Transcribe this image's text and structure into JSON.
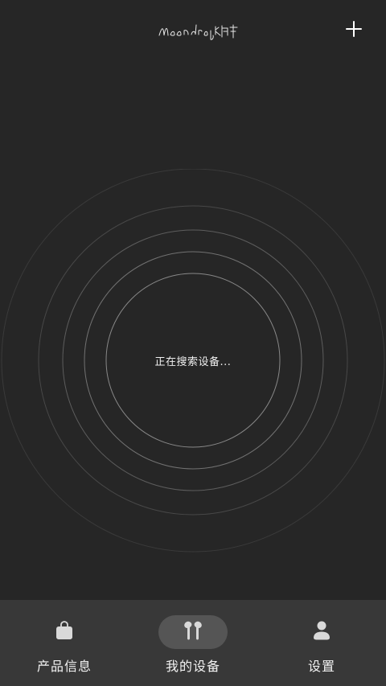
{
  "header": {
    "logo_icon": "moondrop-signature-logo",
    "add_icon": "plus-icon"
  },
  "main": {
    "status_text": "正在搜索设备..."
  },
  "tabbar": {
    "items": [
      {
        "label": "产品信息",
        "icon": "shopping-bag-icon",
        "active": false
      },
      {
        "label": "我的设备",
        "icon": "earbuds-icon",
        "active": true
      },
      {
        "label": "设置",
        "icon": "person-icon",
        "active": false
      }
    ]
  },
  "colors": {
    "background": "#262626",
    "tabbar": "#383838",
    "active_tab_pill": "#555555",
    "text": "#f0f0f0",
    "ring": "#8a8a8a",
    "icon": "#d9d9d9"
  }
}
